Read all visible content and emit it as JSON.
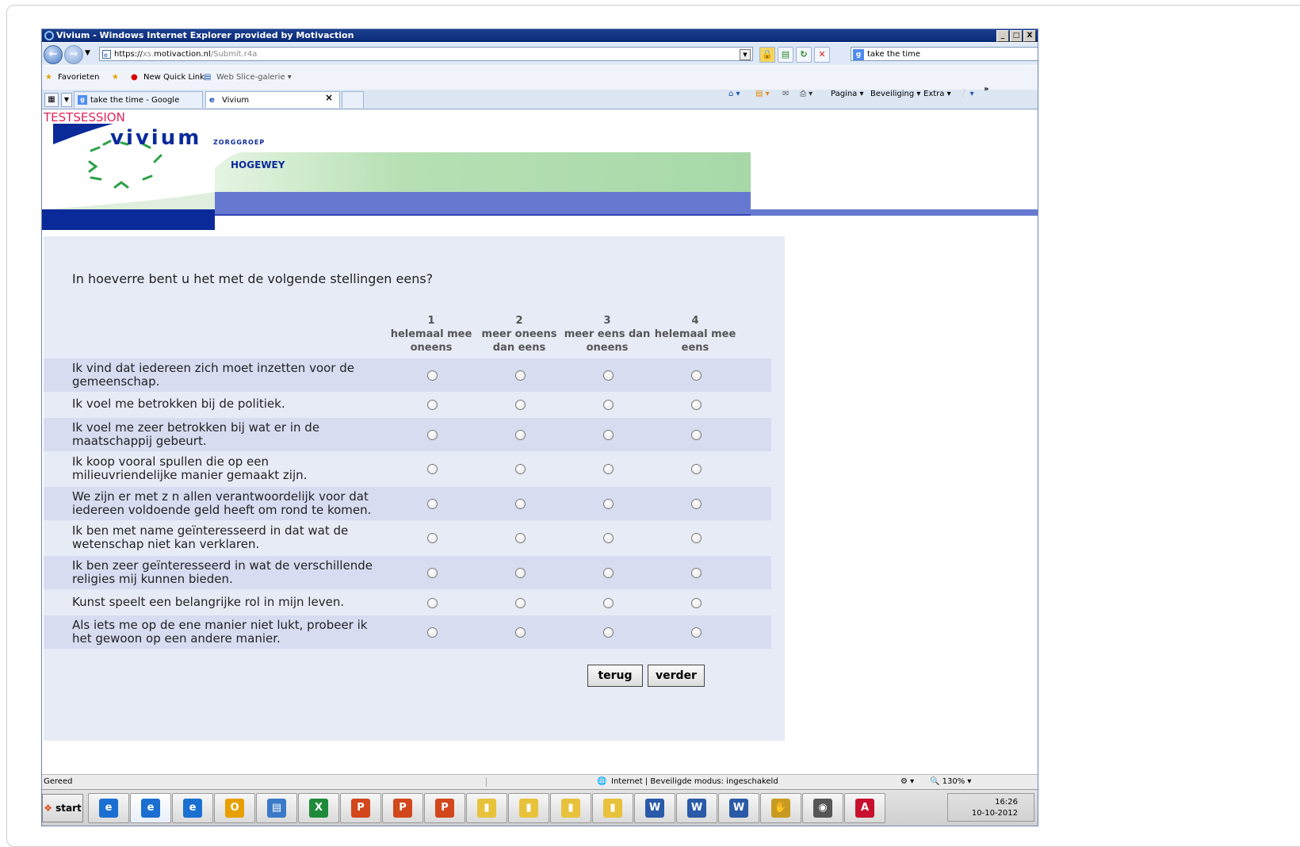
{
  "window": {
    "title": "Vivium - Windows Internet Explorer provided by Motivaction",
    "min": "_",
    "max": "□",
    "close": "X"
  },
  "address": {
    "scheme": "https://",
    "host_prefix": "xs.",
    "host": "motivaction.nl",
    "path": "/Submit.r4a"
  },
  "search": {
    "value": "take the time"
  },
  "favorites": {
    "label": "Favorieten",
    "quicklink": "New Quick Link",
    "webslice": "Web Slice-galerie ▾"
  },
  "tabs": [
    {
      "label": "take the time - Google zoeken"
    },
    {
      "label": "Vivium",
      "close": "×"
    }
  ],
  "commandbar": {
    "pagina": "Pagina ▾",
    "beveiliging": "Beveiliging ▾",
    "extra": "Extra ▾",
    "more": "»"
  },
  "page": {
    "testsession": "TESTSESSION",
    "logo_text": "vivium",
    "logo_sub": "ZORGGROEP",
    "location": "HOGEWEY",
    "question": "In hoeverre bent u het met de volgende stellingen eens?",
    "scale": [
      {
        "num": "1",
        "line1": "helemaal mee",
        "line2": "oneens"
      },
      {
        "num": "2",
        "line1": "meer oneens",
        "line2": "dan eens"
      },
      {
        "num": "3",
        "line1": "meer eens dan",
        "line2": "oneens"
      },
      {
        "num": "4",
        "line1": "helemaal mee",
        "line2": "eens"
      }
    ],
    "statements": [
      {
        "l1": "Ik vind dat iedereen zich moet inzetten voor de",
        "l2": "gemeenschap."
      },
      {
        "l1": "Ik voel me betrokken bij de politiek.",
        "l2": ""
      },
      {
        "l1": "Ik voel me zeer betrokken bij wat er in de",
        "l2": "maatschappij gebeurt."
      },
      {
        "l1": "Ik koop vooral spullen die op een",
        "l2": "milieuvriendelijke manier gemaakt zijn."
      },
      {
        "l1": "We zijn er met z n allen verantwoordelijk voor dat",
        "l2": "iedereen voldoende geld heeft om rond te komen."
      },
      {
        "l1": "Ik ben met name geïnteresseerd in dat wat de",
        "l2": "wetenschap niet kan verklaren."
      },
      {
        "l1": "Ik ben zeer geïnteresseerd in wat de verschillende",
        "l2": "religies mij kunnen bieden."
      },
      {
        "l1": "Kunst speelt een belangrijke rol in mijn leven.",
        "l2": ""
      },
      {
        "l1": "Als iets me op de ene manier niet lukt, probeer ik",
        "l2": "het gewoon op een andere manier."
      }
    ],
    "back_button": "terug",
    "next_button": "verder"
  },
  "status": {
    "left": "Gereed",
    "zone": "Internet | Beveiligde modus: ingeschakeld",
    "zoom": "130%"
  },
  "taskbar": {
    "start": "start",
    "time": "16:26",
    "date": "10-10-2012"
  },
  "colors": {
    "accent_blue": "#0b2a9a",
    "bar_blue": "#6679d0",
    "panel": "#e7ebf6",
    "row_shade": "#d7dcf1",
    "testsession": "#e0245a"
  }
}
